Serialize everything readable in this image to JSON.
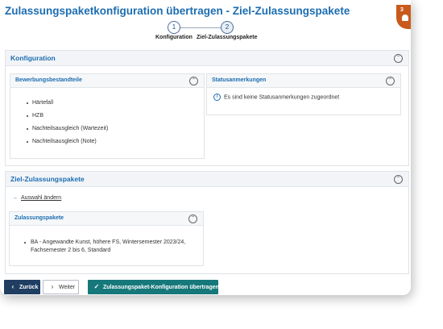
{
  "page": {
    "title": "Zulassungspaketkonfiguration übertragen - Ziel-Zulassungspakete",
    "notification_count": "3"
  },
  "stepper": {
    "steps": [
      {
        "number": "1",
        "label": "Konfiguration"
      },
      {
        "number": "2",
        "label": "Ziel-Zulassungspakete"
      }
    ],
    "active_step": 2
  },
  "konfiguration": {
    "title": "Konfiguration",
    "bewerbung": {
      "title": "Bewerbungsbestandteile",
      "items": [
        "Härtefall",
        "HZB",
        "Nachteilsausgleich (Wartezeit)",
        "Nachteilsausgleich (Note)"
      ]
    },
    "status": {
      "title": "Statusanmerkungen",
      "message": "Es sind keine Statusanmerkungen zugeordnet"
    }
  },
  "ziel": {
    "title": "Ziel-Zulassungspakete",
    "change_link": "Auswahl ändern",
    "pakete": {
      "title": "Zulassungspakete",
      "line1": "BA - Angewandte Kunst, höhere FS, Wintersemester 2023/24,",
      "line2": "Fachsemester 2 bis 6, Standard"
    }
  },
  "footer": {
    "back": "Zurück",
    "next": "Weiter",
    "submit": "Zulassungspaket-Konfiguration übertragen"
  },
  "colors": {
    "accent": "#1c6db1",
    "back_button": "#1f3e62",
    "submit_button": "#16787a",
    "notification": "#c95a1c"
  }
}
